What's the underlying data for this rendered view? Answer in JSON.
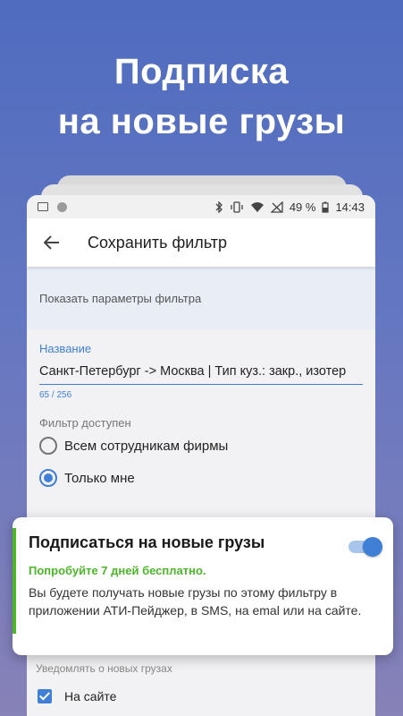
{
  "headline": {
    "line1": "Подписка",
    "line2": "на новые грузы"
  },
  "status_bar": {
    "battery": "49 %",
    "time": "14:43",
    "icons": [
      "image-icon",
      "circle-icon",
      "bluetooth-icon",
      "vibrate-icon",
      "wifi-icon",
      "signal-icon",
      "battery-icon"
    ]
  },
  "toolbar": {
    "title": "Сохранить фильтр",
    "back_icon": "arrow-left-icon"
  },
  "show_params": {
    "label": "Показать параметры фильтра"
  },
  "name_field": {
    "label": "Название",
    "value": "Санкт-Петербург -> Москва | Тип куз.: закр., изотер",
    "counter": "65 / 256"
  },
  "access": {
    "label": "Фильтр доступен",
    "options": [
      {
        "label": "Всем сотрудникам фирмы",
        "checked": false
      },
      {
        "label": "Только мне",
        "checked": true
      }
    ]
  },
  "promo": {
    "title": "Подписаться на новые грузы",
    "trial": "Попробуйте 7 дней бесплатно.",
    "description": "Вы будете получать новые грузы по этому фильтру в приложении АТИ-Пейджер, в SMS, на emal или на сайте.",
    "toggle_on": true
  },
  "notify": {
    "label": "Уведомлять о новых грузах",
    "site_option": "На сайте",
    "site_checked": true
  },
  "colors": {
    "accent": "#3f7fd6",
    "green": "#4cb52a",
    "bg_top": "#4f6cbf",
    "bg_bottom": "#8782b8"
  }
}
